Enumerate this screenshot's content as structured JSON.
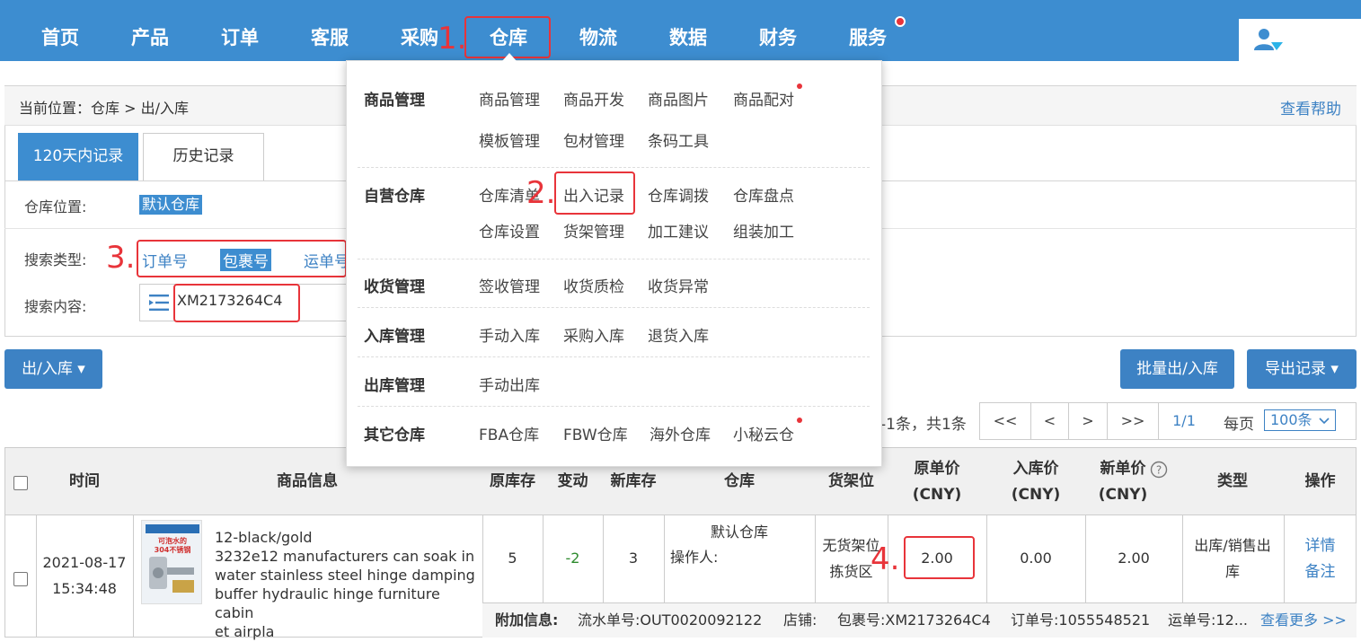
{
  "nav": {
    "items": [
      "首页",
      "产品",
      "订单",
      "客服",
      "采购",
      "仓库",
      "物流",
      "数据",
      "财务",
      "服务"
    ]
  },
  "annotations": {
    "a1": "1.",
    "a2": "2.",
    "a3": "3.",
    "a4": "4."
  },
  "breadcrumb": {
    "text": "当前位置：仓库 > 出/入库",
    "help": "查看帮助"
  },
  "tabs": {
    "active": "120天内记录",
    "history": "历史记录"
  },
  "filters": {
    "warehouse_label": "仓库位置:",
    "warehouse_value": "默认仓库",
    "search_type_label": "搜索类型:",
    "search_types": [
      "订单号",
      "包裹号",
      "运单号"
    ],
    "search_content_label": "搜索内容:",
    "search_value": "XM2173264C4"
  },
  "dropdown": {
    "groups": [
      {
        "title": "商品管理",
        "items": [
          "商品管理",
          "商品开发",
          "商品图片",
          "商品配对",
          "模板管理",
          "包材管理",
          "条码工具"
        ]
      },
      {
        "title": "自营仓库",
        "items": [
          "仓库清单",
          "出入记录",
          "仓库调拨",
          "仓库盘点",
          "仓库设置",
          "货架管理",
          "加工建议",
          "组装加工"
        ]
      },
      {
        "title": "收货管理",
        "items": [
          "签收管理",
          "收货质检",
          "收货异常"
        ]
      },
      {
        "title": "入库管理",
        "items": [
          "手动入库",
          "采购入库",
          "退货入库"
        ]
      },
      {
        "title": "出库管理",
        "items": [
          "手动出库"
        ]
      },
      {
        "title": "其它仓库",
        "items": [
          "FBA仓库",
          "FBW仓库",
          "海外仓库",
          "小秘云仓"
        ]
      }
    ]
  },
  "toolbar": {
    "inout_button": "出/入库 ▾",
    "batch_button": "批量出/入库",
    "export_button": "导出记录 ▾"
  },
  "pager": {
    "info": "-1条，共1条",
    "first": "<<",
    "prev": "<",
    "next": ">",
    "last": ">>",
    "current": "1/1",
    "per_page_label": "每页",
    "per_page_value": "100条"
  },
  "table": {
    "headers": {
      "time": "时间",
      "product": "商品信息",
      "orig_stock": "原库存",
      "change": "变动",
      "new_stock": "新库存",
      "warehouse": "仓库",
      "shelf": "货架位",
      "orig_price_1": "原单价",
      "orig_price_2": "(CNY)",
      "in_price_1": "入库价",
      "in_price_2": "(CNY)",
      "new_price_1": "新单价",
      "new_price_2": "(CNY)",
      "type": "类型",
      "action": "操作"
    },
    "row": {
      "date": "2021-08-17",
      "time": "15:34:48",
      "sku": "12-black/gold",
      "title_lines": [
        "3232e12 manufacturers can soak in",
        "water stainless steel hinge damping",
        "buffer hydraulic hinge furniture cabin",
        "et airpla"
      ],
      "img_text_1": "可泡水的",
      "img_text_2": "304不锈钢",
      "orig_stock": "5",
      "change": "-2",
      "new_stock": "3",
      "warehouse": "默认仓库",
      "operator": "操作人:",
      "shelf_1": "无货架位",
      "shelf_2": "拣货区",
      "orig_price": "2.00",
      "in_price": "0.00",
      "new_price": "2.00",
      "type_1": "出库/销售出",
      "type_2": "库",
      "detail": "详情",
      "note": "备注",
      "extra_label": "附加信息:",
      "serial": "流水单号:OUT0020092122",
      "shop": "店铺:",
      "package": "包裹号:XM2173264C4",
      "order": "订单号:1055548521",
      "waybill": "运单号:12...",
      "more": "查看更多 >>"
    }
  },
  "colors": {
    "primary": "#3d8dd0",
    "annotation": "#e8343a",
    "change": "#2e8b2e"
  }
}
